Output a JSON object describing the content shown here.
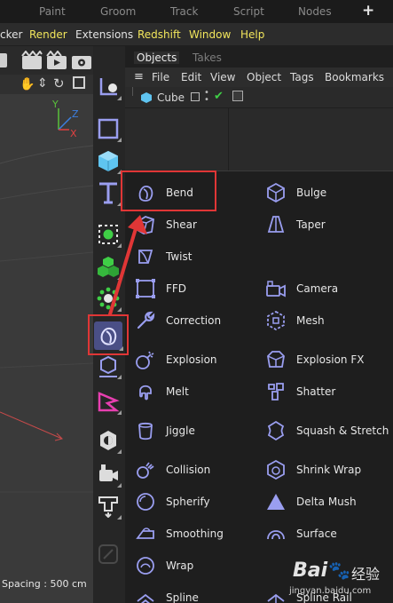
{
  "tabbar": {
    "tabs": [
      "Paint",
      "Groom",
      "Track",
      "Script",
      "Nodes"
    ],
    "plus": "+"
  },
  "menubar": {
    "items": [
      "cker",
      "Render",
      "Extensions",
      "Redshift",
      "Window",
      "Help"
    ]
  },
  "viewport": {
    "axis_y": "Y",
    "axis_z": "Z",
    "axis_x": "X",
    "grid_spacing": "Spacing : 500 cm"
  },
  "objects_panel": {
    "tabs": [
      "Objects",
      "Takes"
    ],
    "menu": [
      "File",
      "Edit",
      "View",
      "Object",
      "Tags",
      "Bookmarks"
    ],
    "object_name": "Cube"
  },
  "deformers": {
    "left": [
      "Bend",
      "Shear",
      "Twist",
      "FFD",
      "Correction",
      "Explosion",
      "Melt",
      "Jiggle",
      "Collision",
      "Spherify",
      "Smoothing",
      "Wrap",
      "Spline"
    ],
    "right": [
      "Bulge",
      "Taper",
      "Camera",
      "Mesh",
      "Explosion FX",
      "Shatter",
      "Squash & Stretch",
      "Shrink Wrap",
      "Delta Mush",
      "Surface",
      "Spline Rail"
    ]
  },
  "watermark": {
    "brand": "Bai",
    "brand_cn": "经验",
    "url": "jingyan.baidu.com"
  },
  "colors": {
    "accent_icon": "#9a9ef0",
    "highlight": "#e03636",
    "selected_tool_bg": "#4a4f86",
    "menu_yellow": "#f2e65c"
  }
}
